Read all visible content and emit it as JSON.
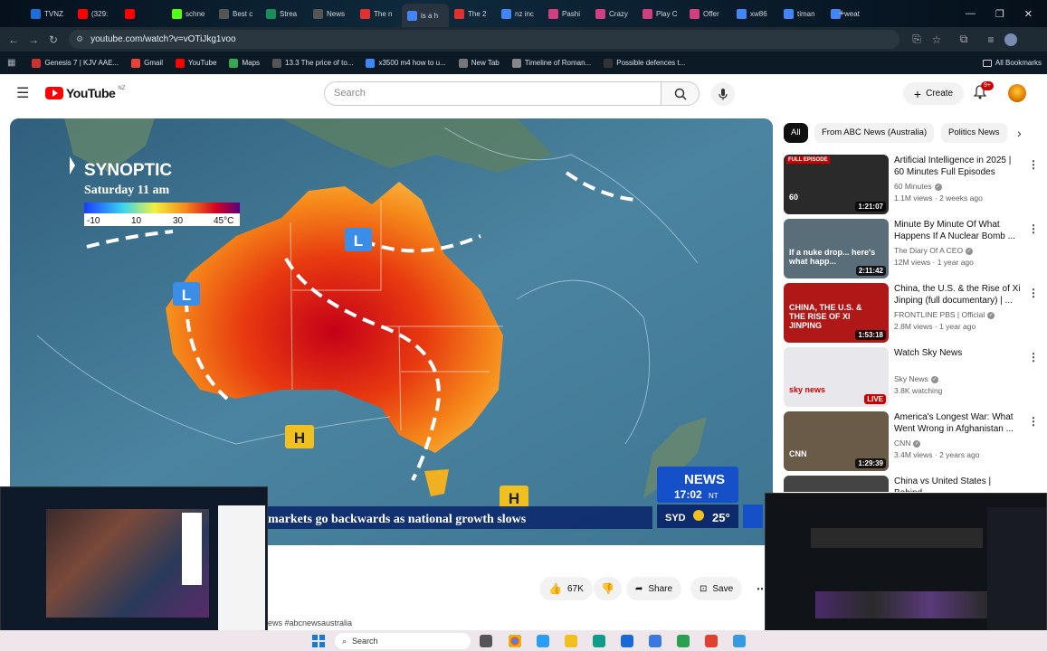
{
  "browser": {
    "tabs": [
      {
        "label": "TVNZ",
        "color": "#1d6fd6"
      },
      {
        "label": "(329:",
        "color": "#ff0000"
      },
      {
        "label": "",
        "color": "#ff0000"
      },
      {
        "label": "schne",
        "color": "#53fc18"
      },
      {
        "label": "Best c",
        "color": "#555"
      },
      {
        "label": "Strea",
        "color": "#1a8c5a"
      },
      {
        "label": "News",
        "color": "#555"
      },
      {
        "label": "The n",
        "color": "#e03030"
      },
      {
        "label": "is a h",
        "color": "#4285f4"
      },
      {
        "label": "The 2",
        "color": "#e03030"
      },
      {
        "label": "nz inc",
        "color": "#4285f4"
      },
      {
        "label": "Pashi",
        "color": "#d04080"
      },
      {
        "label": "Crazy",
        "color": "#d04080"
      },
      {
        "label": "Play C",
        "color": "#d04080"
      },
      {
        "label": "Offer",
        "color": "#d04080"
      },
      {
        "label": "xw86",
        "color": "#4285f4"
      },
      {
        "label": "timan",
        "color": "#4285f4"
      },
      {
        "label": "weat",
        "color": "#4285f4"
      }
    ],
    "url": "youtube.com/watch?v=vOTiJkg1voo",
    "bookmarks": [
      {
        "label": "Genesis 7 | KJV AAE...",
        "color": "#d03030"
      },
      {
        "label": "Gmail",
        "color": "#ea4335"
      },
      {
        "label": "YouTube",
        "color": "#ff0000"
      },
      {
        "label": "Maps",
        "color": "#34a853"
      },
      {
        "label": "13.3 The price of to...",
        "color": "#555"
      },
      {
        "label": "x3500 m4 how to u...",
        "color": "#4285f4"
      },
      {
        "label": "New Tab",
        "color": "#777"
      },
      {
        "label": "Timeline of Roman...",
        "color": "#888"
      },
      {
        "label": "Possible defences t...",
        "color": "#333"
      }
    ],
    "all_bookmarks": "All Bookmarks"
  },
  "youtube": {
    "logo_text": "YouTube",
    "region": "NZ",
    "search_placeholder": "Search",
    "create_label": "Create",
    "notif_count": "9+"
  },
  "video": {
    "map_title": "SYNOPTIC",
    "map_subtitle": "Saturday 11 am",
    "legend_ticks": [
      "-10",
      "10",
      "30",
      "45°C"
    ],
    "low_label": "L",
    "high_label": "H",
    "ticker": "markets go backwards as national growth slows",
    "brand": "NEWS",
    "time": "17:02",
    "time_zone": "NT",
    "city": "SYD",
    "temp": "25°"
  },
  "chips": [
    "All",
    "From ABC News (Australia)",
    "Politics News"
  ],
  "recommendations": [
    {
      "title": "Artificial Intelligence in 2025 | 60 Minutes Full Episodes",
      "channel": "60 Minutes",
      "meta": "1.1M views · 2 weeks ago",
      "duration": "1:21:07",
      "badge": "FULL EPISODE",
      "thumb_label": "60",
      "thumb_color": "#2a2a2a"
    },
    {
      "title": "Minute By Minute Of What Happens If A Nuclear Bomb ...",
      "channel": "The Diary Of A CEO",
      "meta": "12M views · 1 year ago",
      "duration": "2:11:42",
      "badge": "",
      "thumb_label": "If a nuke drop... here's what happ...",
      "thumb_color": "#5a6e7a"
    },
    {
      "title": "China, the U.S. & the Rise of Xi Jinping (full documentary) | ...",
      "channel": "FRONTLINE PBS | Official",
      "meta": "2.8M views · 1 year ago",
      "duration": "1:53:18",
      "badge": "",
      "thumb_label": "CHINA, THE U.S. & THE RISE OF XI JINPING",
      "thumb_color": "#b01818"
    },
    {
      "title": "Watch Sky News",
      "channel": "Sky News",
      "meta": "3.8K watching",
      "duration": "LIVE",
      "badge": "",
      "thumb_label": "sky news",
      "thumb_color": "#e8e8ec"
    },
    {
      "title": "America's Longest War: What Went Wrong in Afghanistan ...",
      "channel": "CNN",
      "meta": "3.4M views · 2 years ago",
      "duration": "1:29:39",
      "badge": "",
      "thumb_label": "CNN",
      "thumb_color": "#6a5a48"
    },
    {
      "title": "China vs United States | Behind",
      "channel": "",
      "meta": "",
      "duration": "",
      "badge": "",
      "thumb_label": "",
      "thumb_color": "#444"
    }
  ],
  "actions": {
    "likes": "67K",
    "share": "Share",
    "save": "Save"
  },
  "description_partial": "ews #abcnewsaustralia",
  "taskbar": {
    "search": "Search"
  }
}
